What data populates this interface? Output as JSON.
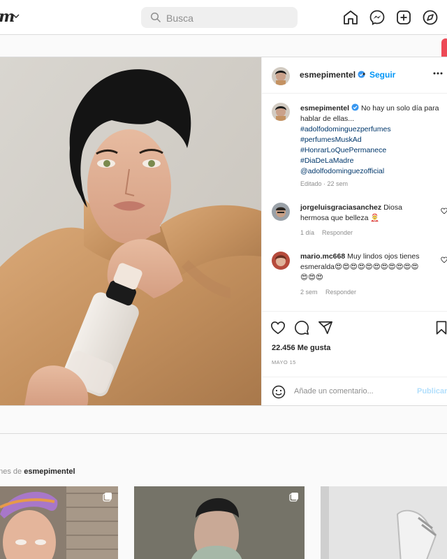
{
  "nav": {
    "logo_fragment": "m",
    "search_placeholder": "Busca",
    "icons": [
      "home-icon",
      "messenger-icon",
      "new-post-icon",
      "explore-icon"
    ]
  },
  "post": {
    "username": "esmepimentel",
    "verified": true,
    "follow_label": "Seguir",
    "caption": {
      "username": "esmepimentel",
      "text": "No hay un solo día para hablar de ellas...",
      "hashtags": [
        "#adolfodominguezperfumes",
        "#perfumesMuskAd",
        "#HonrarLoQuePermanece",
        "#DiaDeLaMadre",
        "@adolfodominguezofficial"
      ],
      "meta": "Editado · 22 sem"
    },
    "comments": [
      {
        "username": "jorgeluisgraciasanchez",
        "text": "Diosa hermosa que belleza 🤶",
        "time": "1 día",
        "reply_label": "Responder"
      },
      {
        "username": "mario.mc668",
        "text": "Muy lindos ojos tienes esmeralda😍😍😍😍😍😍😍😍😍😍😍😍😍😍",
        "time": "2 sem",
        "reply_label": "Responder"
      }
    ],
    "likes": "22.456 Me gusta",
    "date": "MAYO 15",
    "comment_placeholder": "Añade un comentario...",
    "publish_label": "Publicar"
  },
  "more_posts": {
    "label_prefix": "ones de",
    "username": "esmepimentel"
  },
  "colors": {
    "accent": "#0095f6",
    "link": "#00376b",
    "muted": "#8e8e8e",
    "alert": "#ed4956"
  }
}
